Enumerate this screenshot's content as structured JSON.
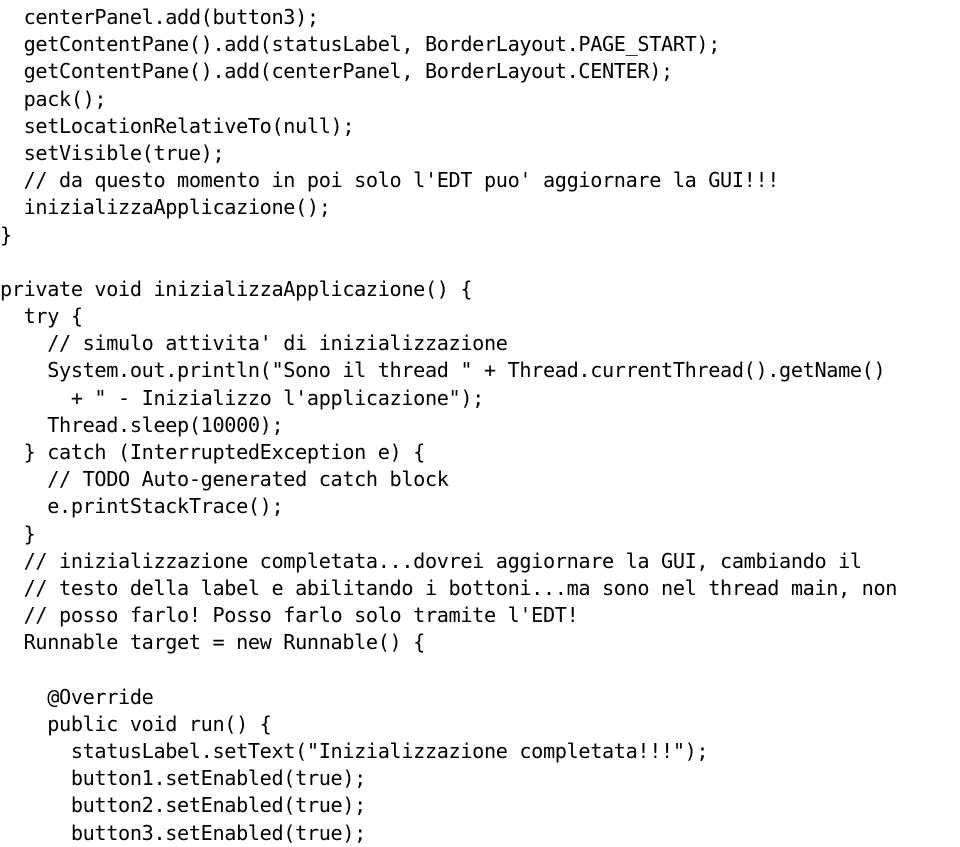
{
  "document": {
    "type": "source-code-listing",
    "language": "Java",
    "background_color": "#ffffff",
    "text_color": "#000000",
    "lines": [
      "  centerPanel.add(button3);",
      "  getContentPane().add(statusLabel, BorderLayout.PAGE_START);",
      "  getContentPane().add(centerPanel, BorderLayout.CENTER);",
      "  pack();",
      "  setLocationRelativeTo(null);",
      "  setVisible(true);",
      "  // da questo momento in poi solo l'EDT puo' aggiornare la GUI!!!",
      "  inizializzaApplicazione();",
      "}",
      "",
      "private void inizializzaApplicazione() {",
      "  try {",
      "    // simulo attivita' di inizializzazione",
      "    System.out.println(\"Sono il thread \" + Thread.currentThread().getName()",
      "      + \" - Inizializzo l'applicazione\");",
      "    Thread.sleep(10000);",
      "  } catch (InterruptedException e) {",
      "    // TODO Auto-generated catch block",
      "    e.printStackTrace();",
      "  }",
      "  // inizializzazione completata...dovrei aggiornare la GUI, cambiando il",
      "  // testo della label e abilitando i bottoni...ma sono nel thread main, non",
      "  // posso farlo! Posso farlo solo tramite l'EDT!",
      "  Runnable target = new Runnable() {",
      "",
      "    @Override",
      "    public void run() {",
      "      statusLabel.setText(\"Inizializzazione completata!!!\");",
      "      button1.setEnabled(true);",
      "      button2.setEnabled(true);",
      "      button3.setEnabled(true);"
    ]
  }
}
